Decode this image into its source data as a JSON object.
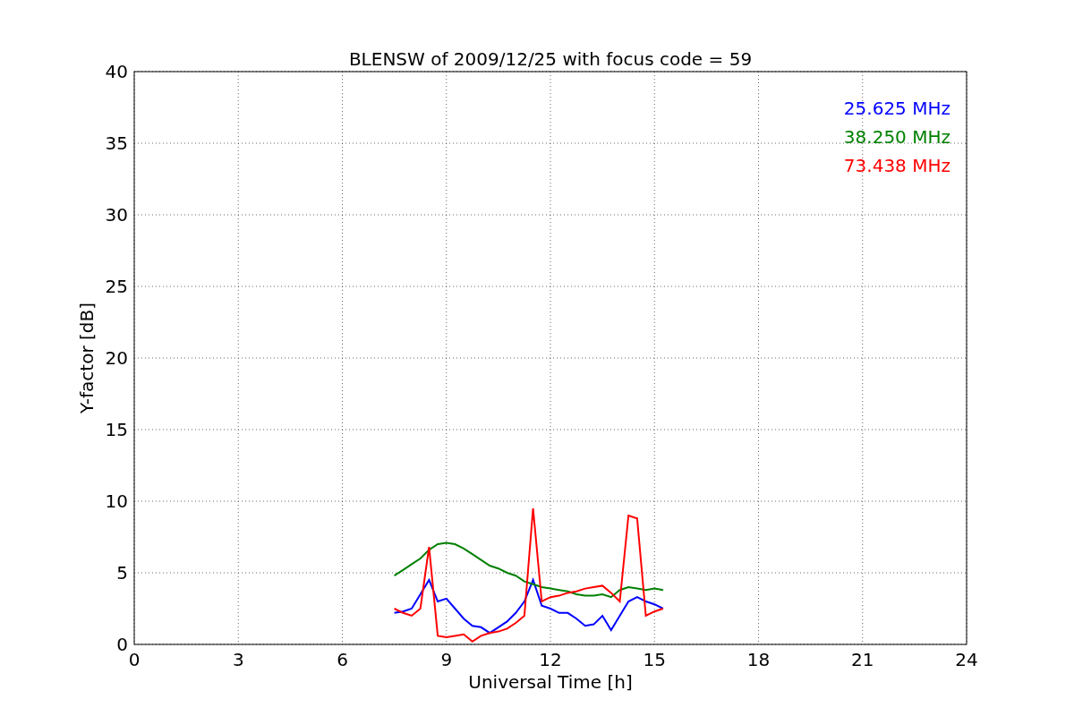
{
  "chart_data": {
    "type": "line",
    "title": "BLENSW of 2009/12/25 with focus code = 59",
    "xlabel": "Universal Time [h]",
    "ylabel": "Y-factor [dB]",
    "x": [
      7.5,
      7.75,
      8,
      8.25,
      8.5,
      8.75,
      9,
      9.25,
      9.5,
      9.75,
      10,
      10.25,
      10.5,
      10.75,
      11,
      11.25,
      11.5,
      11.75,
      12,
      12.25,
      12.5,
      12.75,
      13,
      13.25,
      13.5,
      13.75,
      14,
      14.25,
      14.5,
      14.75,
      15,
      15.25
    ],
    "series": [
      {
        "name": "25.625 MHz",
        "color": "#0000ff",
        "values": [
          2.2,
          2.3,
          2.5,
          3.5,
          4.5,
          3.0,
          3.2,
          2.5,
          1.8,
          1.3,
          1.2,
          0.8,
          1.2,
          1.6,
          2.2,
          3.0,
          4.5,
          2.7,
          2.5,
          2.2,
          2.2,
          1.8,
          1.3,
          1.4,
          2.0,
          1.0,
          2.0,
          3.0,
          3.3,
          3.0,
          2.8,
          2.5
        ]
      },
      {
        "name": "38.250 MHz",
        "color": "#008000",
        "values": [
          4.8,
          5.2,
          5.6,
          6.0,
          6.6,
          7.0,
          7.1,
          7.0,
          6.7,
          6.3,
          5.9,
          5.5,
          5.3,
          5.0,
          4.8,
          4.4,
          4.2,
          4.0,
          3.9,
          3.8,
          3.7,
          3.5,
          3.4,
          3.4,
          3.5,
          3.3,
          3.8,
          4.0,
          3.9,
          3.8,
          3.9,
          3.8
        ]
      },
      {
        "name": "73.438 MHz",
        "color": "#ff0000",
        "values": [
          2.5,
          2.2,
          2.0,
          2.5,
          6.8,
          0.6,
          0.5,
          0.6,
          0.7,
          0.2,
          0.6,
          0.8,
          0.9,
          1.1,
          1.5,
          2.0,
          9.5,
          3.0,
          3.3,
          3.4,
          3.6,
          3.7,
          3.9,
          4.0,
          4.1,
          3.6,
          3.0,
          9.0,
          8.8,
          2.0,
          2.3,
          2.5
        ]
      }
    ],
    "xlim": [
      0,
      24
    ],
    "ylim": [
      0,
      40
    ],
    "xticks": [
      0,
      3,
      6,
      9,
      12,
      15,
      18,
      21,
      24
    ],
    "yticks": [
      0,
      5,
      10,
      15,
      20,
      25,
      30,
      35,
      40
    ],
    "grid": true
  }
}
